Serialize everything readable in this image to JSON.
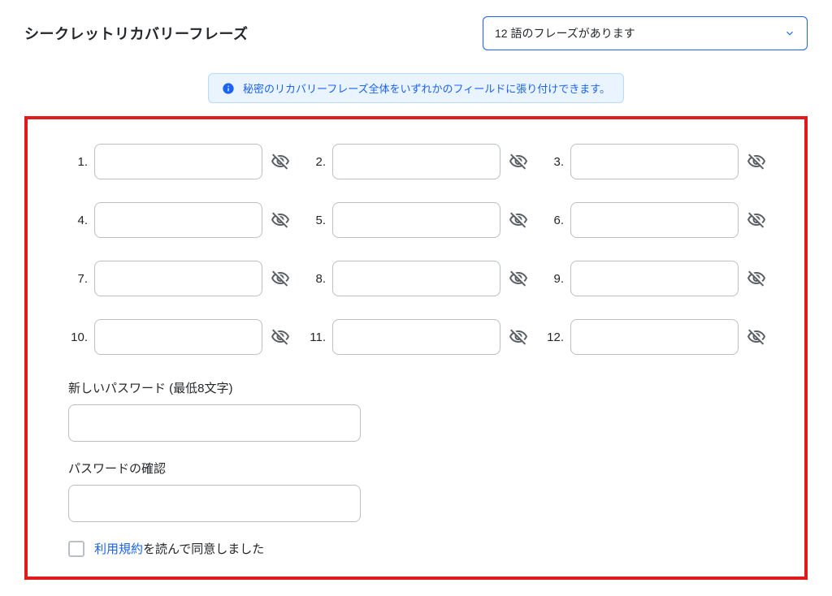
{
  "header": {
    "title": "シークレットリカバリーフレーズ",
    "select_label": "12 語のフレーズがあります"
  },
  "info_banner": "秘密のリカバリーフレーズ全体をいずれかのフィールドに張り付けできます。",
  "words": [
    {
      "n": "1."
    },
    {
      "n": "2."
    },
    {
      "n": "3."
    },
    {
      "n": "4."
    },
    {
      "n": "5."
    },
    {
      "n": "6."
    },
    {
      "n": "7."
    },
    {
      "n": "8."
    },
    {
      "n": "9."
    },
    {
      "n": "10."
    },
    {
      "n": "11."
    },
    {
      "n": "12."
    }
  ],
  "password": {
    "new_label": "新しいパスワード (最低8文字)",
    "confirm_label": "パスワードの確認"
  },
  "terms": {
    "link": "利用規約",
    "rest": "を読んで同意しました"
  }
}
